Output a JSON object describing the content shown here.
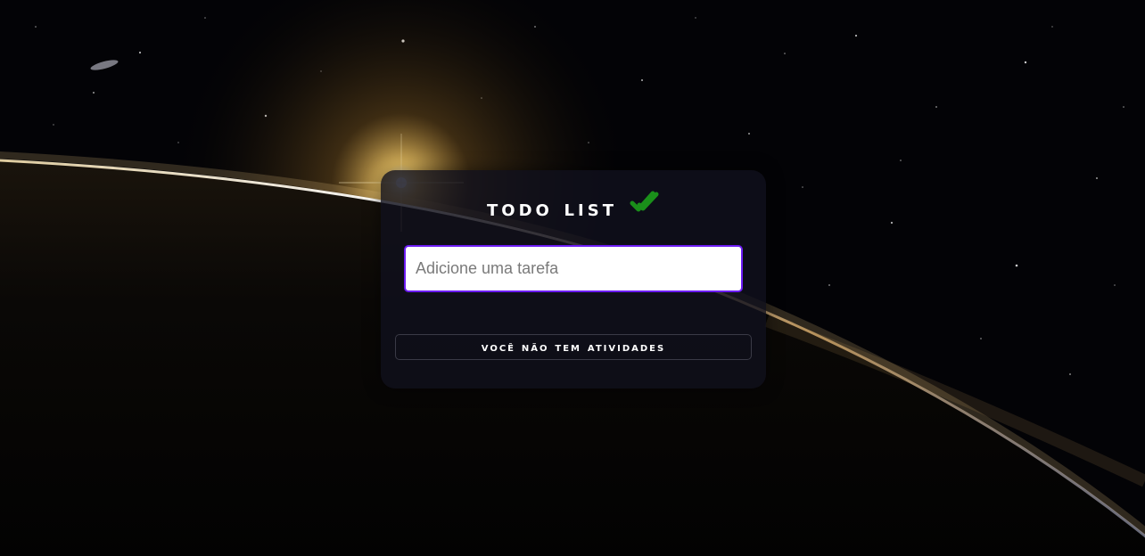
{
  "app": {
    "title": "TODO LIST",
    "title_icon": "check-double-icon",
    "accent_color": "#6c1cf2",
    "check_color": "#1a8f1a"
  },
  "input": {
    "placeholder": "Adicione uma tarefa",
    "value": ""
  },
  "list": {
    "empty_message": "VOCÊ NÃO TEM ATIVIDADES",
    "items": []
  }
}
